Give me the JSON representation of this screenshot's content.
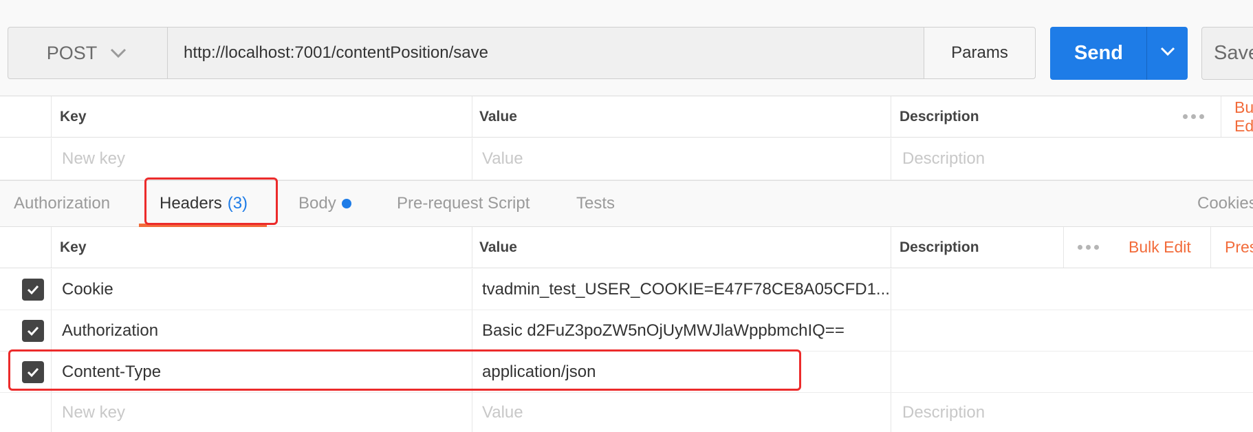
{
  "request": {
    "method": "POST",
    "url": "http://localhost:7001/contentPosition/save",
    "params_label": "Params",
    "send_label": "Send",
    "save_label": "Save"
  },
  "params_table": {
    "col_key": "Key",
    "col_value": "Value",
    "col_description": "Description",
    "bulk_label": "Bulk Edit",
    "new_key_placeholder": "New key",
    "new_value_placeholder": "Value",
    "new_description_placeholder": "Description"
  },
  "tabs": {
    "authorization": "Authorization",
    "headers": "Headers",
    "headers_count": "(3)",
    "body": "Body",
    "prerequest": "Pre-request Script",
    "tests": "Tests",
    "cookies": "Cookies"
  },
  "headers_table": {
    "col_key": "Key",
    "col_value": "Value",
    "col_description": "Description",
    "bulk_edit": "Bulk Edit",
    "presets": "Presets",
    "rows": [
      {
        "key": "Cookie",
        "value": "tvadmin_test_USER_COOKIE=E47F78CE8A05CFD1...",
        "checked": true
      },
      {
        "key": "Authorization",
        "value": "Basic d2FuZ3poZW5nOjUyMWJlaWppbmchIQ==",
        "checked": true
      },
      {
        "key": "Content-Type",
        "value": "application/json",
        "checked": true
      }
    ],
    "new_key_placeholder": "New key",
    "new_value_placeholder": "Value",
    "new_description_placeholder": "Description"
  },
  "colors": {
    "accent_blue": "#1e7ce7",
    "accent_orange": "#f26b3a",
    "highlight_red": "#ec2b2b"
  }
}
